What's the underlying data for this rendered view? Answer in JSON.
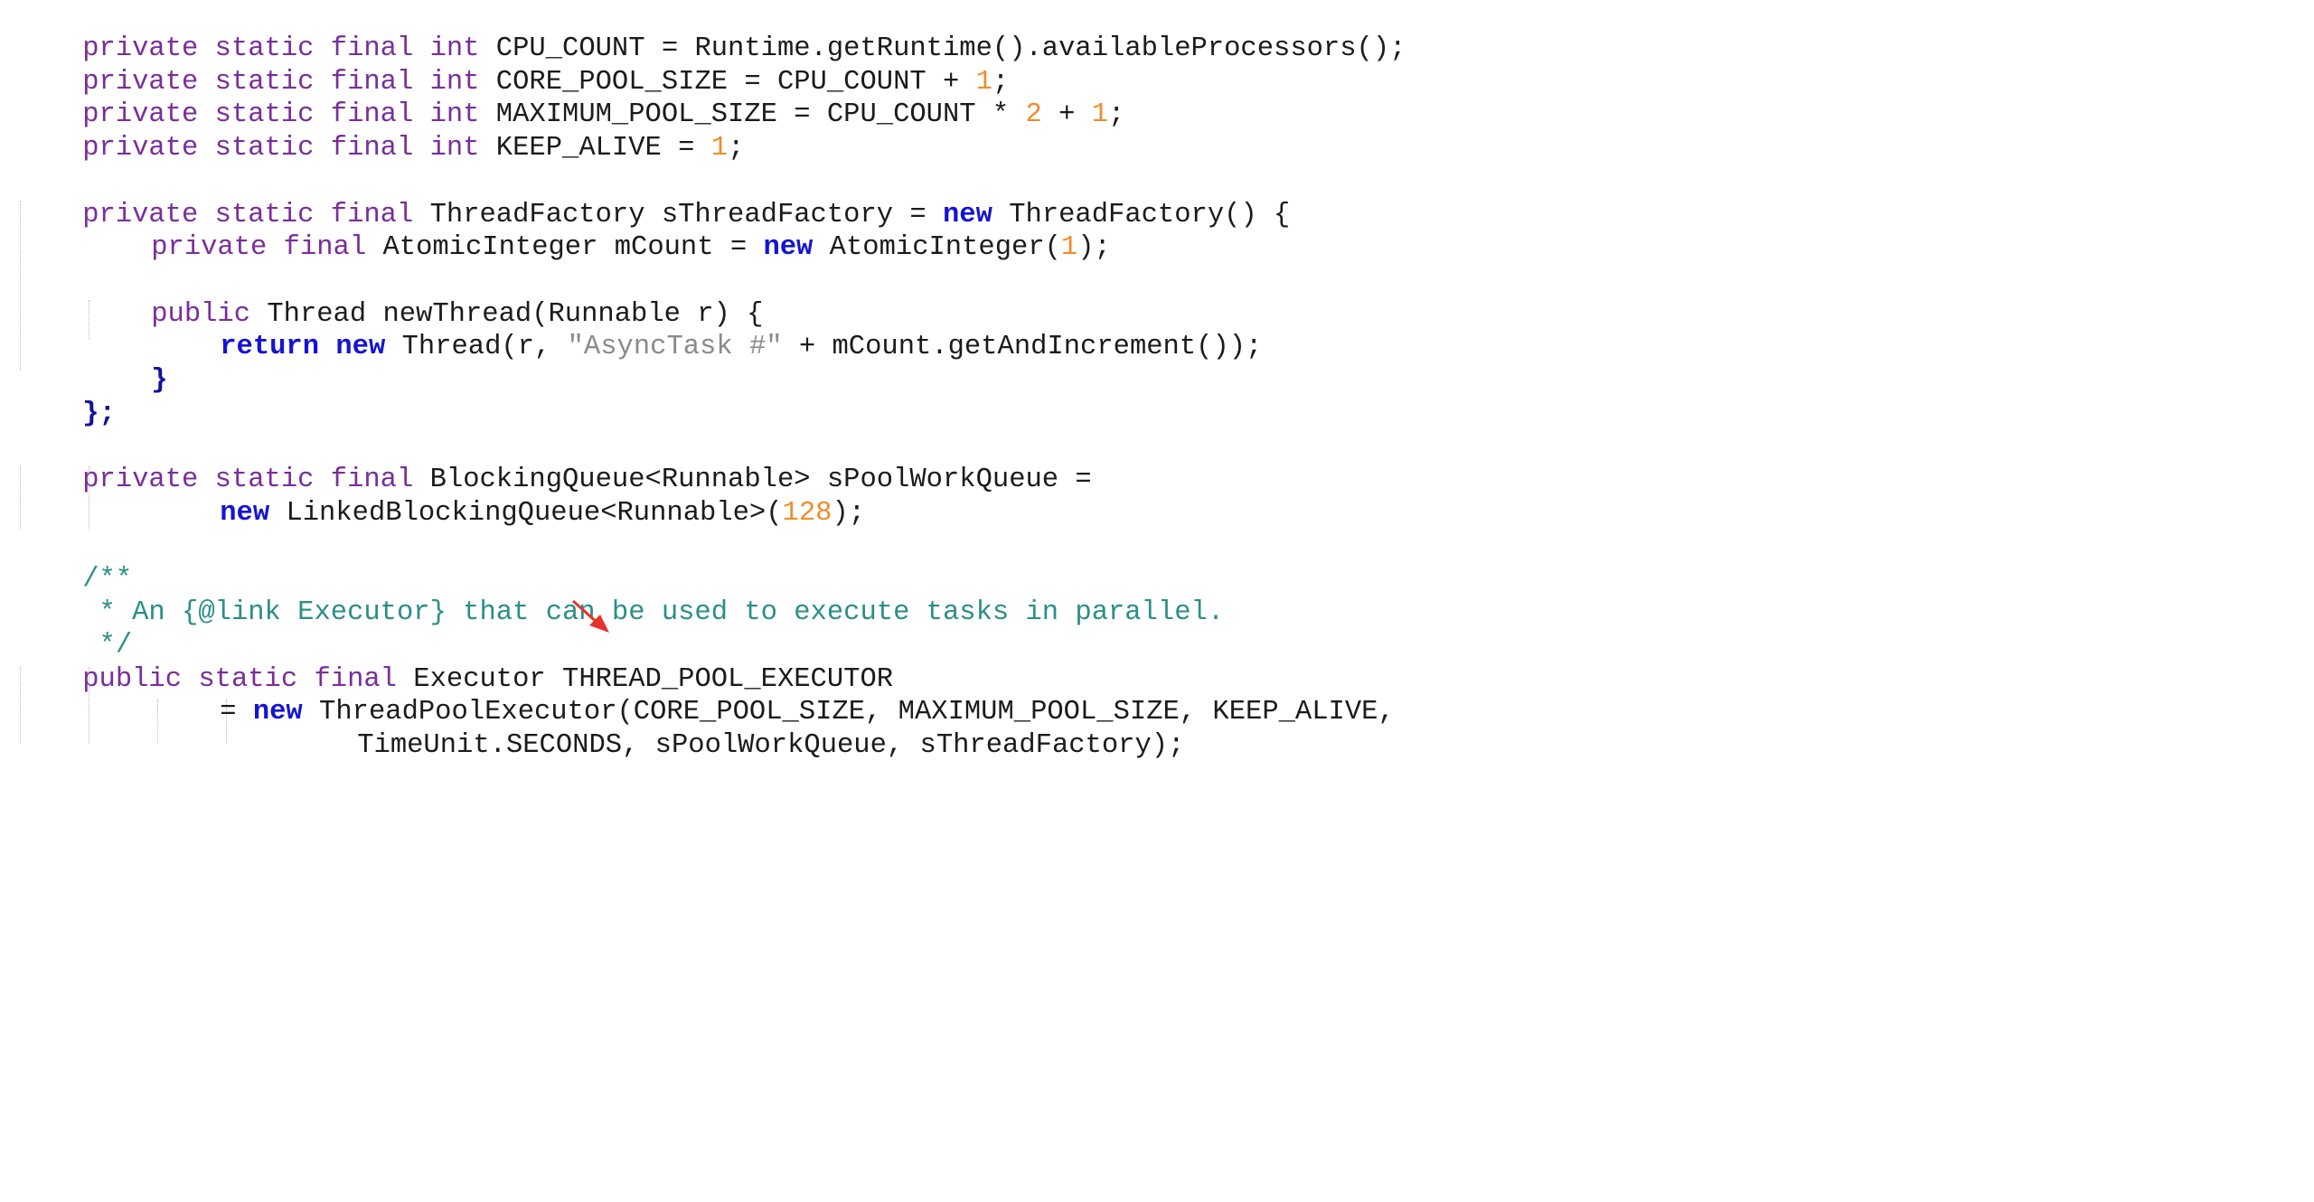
{
  "code": {
    "line1": {
      "kw": "private static final int",
      "text": " CPU_COUNT = Runtime.getRuntime().availableProcessors();"
    },
    "line2": {
      "kw": "private static final int",
      "pre": " CORE_POOL_SIZE = CPU_COUNT + ",
      "num": "1",
      "post": ";"
    },
    "line3": {
      "kw": "private static final int",
      "pre": " MAXIMUM_POOL_SIZE = CPU_COUNT * ",
      "num1": "2",
      "mid": " + ",
      "num2": "1",
      "post": ";"
    },
    "line4": {
      "kw": "private static final int",
      "pre": " KEEP_ALIVE = ",
      "num": "1",
      "post": ";"
    },
    "line6": {
      "kw": "private static final",
      "pre": " ThreadFactory sThreadFactory = ",
      "kw2": "new",
      "post": " ThreadFactory() {"
    },
    "line7": {
      "kw": "private final",
      "pre": " AtomicInteger mCount = ",
      "kw2": "new",
      "mid": " AtomicInteger(",
      "num": "1",
      "post": ");"
    },
    "line9": {
      "kw": "public",
      "post": " Thread newThread(Runnable r) {"
    },
    "line10": {
      "kw1": "return",
      "kw2": "new",
      "pre": " Thread(r, ",
      "str": "\"AsyncTask #\"",
      "post": " + mCount.getAndIncrement());"
    },
    "line11": {
      "text": "}"
    },
    "line12": {
      "text": "};"
    },
    "line14": {
      "kw": "private static final",
      "post": " BlockingQueue<Runnable> sPoolWorkQueue ="
    },
    "line15": {
      "kw": "new",
      "pre": " LinkedBlockingQueue<Runnable>(",
      "num": "128",
      "post": ");"
    },
    "line17": {
      "text": "/**"
    },
    "line18": {
      "text": " * An {@link Executor} that can be used to execute tasks in parallel."
    },
    "line19": {
      "text": " */"
    },
    "line20": {
      "kw": "public static final",
      "post": " Executor THREAD_POOL_EXECUTOR"
    },
    "line21": {
      "pre": "= ",
      "kw": "new",
      "post": " ThreadPoolExecutor(CORE_POOL_SIZE, MAXIMUM_POOL_SIZE, KEEP_ALIVE,"
    },
    "line22": {
      "text": "TimeUnit.SECONDS, sPoolWorkQueue, sThreadFactory);"
    }
  },
  "colors": {
    "keyword": "#7a2e9a",
    "keyword_bold": "#1414d2",
    "number": "#f08c28",
    "string": "#8a8a8a",
    "comment": "#2a8f87",
    "arrow": "#e8322c"
  }
}
